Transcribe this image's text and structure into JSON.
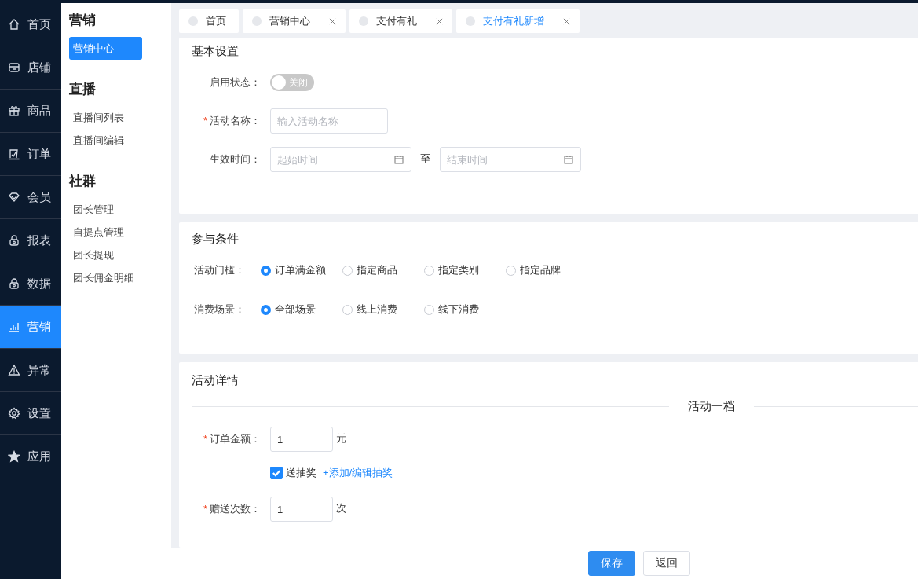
{
  "nav": [
    {
      "label": "首页",
      "kind": "home",
      "selected": false
    },
    {
      "label": "店铺",
      "kind": "store",
      "selected": false
    },
    {
      "label": "商品",
      "kind": "gift",
      "selected": false
    },
    {
      "label": "订单",
      "kind": "order",
      "selected": false
    },
    {
      "label": "会员",
      "kind": "member",
      "selected": false
    },
    {
      "label": "报表",
      "kind": "lock",
      "selected": false
    },
    {
      "label": "数据",
      "kind": "lock",
      "selected": false
    },
    {
      "label": "营销",
      "kind": "chart",
      "selected": true
    },
    {
      "label": "异常",
      "kind": "warning",
      "selected": false
    },
    {
      "label": "设置",
      "kind": "gear",
      "selected": false
    },
    {
      "label": "应用",
      "kind": "star",
      "selected": false
    }
  ],
  "submenu": [
    {
      "title": "营销",
      "items": [
        {
          "label": "营销中心",
          "selected": true
        }
      ]
    },
    {
      "title": "直播",
      "items": [
        {
          "label": "直播间列表",
          "selected": false
        },
        {
          "label": "直播间编辑",
          "selected": false
        }
      ]
    },
    {
      "title": "社群",
      "items": [
        {
          "label": "团长管理",
          "selected": false
        },
        {
          "label": "自提点管理",
          "selected": false
        },
        {
          "label": "团长提现",
          "selected": false
        },
        {
          "label": "团长佣金明细",
          "selected": false
        }
      ]
    }
  ],
  "tabs": [
    {
      "label": "首页",
      "selected": false,
      "closable": false
    },
    {
      "label": "营销中心",
      "selected": false,
      "closable": true
    },
    {
      "label": "支付有礼",
      "selected": false,
      "closable": true
    },
    {
      "label": "支付有礼新增",
      "selected": true,
      "closable": true
    }
  ],
  "basic_settings": {
    "title": "基本设置",
    "status": {
      "label": "启用状态：",
      "on": false,
      "text": "关闭"
    },
    "name": {
      "label": "活动名称：",
      "required_mark": "*",
      "placeholder": "输入活动名称"
    },
    "time": {
      "label": "生效时间：",
      "start_placeholder": "起始时间",
      "separator": "至",
      "end_placeholder": "结束时间"
    }
  },
  "conditions": {
    "title": "参与条件",
    "rows": [
      {
        "label": "活动门槛：",
        "options": [
          {
            "label": "订单满金额",
            "selected": true
          },
          {
            "label": "指定商品",
            "selected": false
          },
          {
            "label": "指定类别",
            "selected": false
          },
          {
            "label": "指定品牌",
            "selected": false
          }
        ]
      },
      {
        "label": "消费场景：",
        "options": [
          {
            "label": "全部场景",
            "selected": true
          },
          {
            "label": "线上消费",
            "selected": false
          },
          {
            "label": "线下消费",
            "selected": false
          }
        ]
      }
    ]
  },
  "details": {
    "title": "活动详情",
    "tier_title": "活动一档",
    "order_amount": {
      "label": "订单金额：",
      "required_mark": "*",
      "value": "1",
      "unit": "元"
    },
    "lottery": {
      "label": "送抽奖",
      "checked": true,
      "link": "+添加/编辑抽奖"
    },
    "gift_count": {
      "label": "赠送次数：",
      "required_mark": "*",
      "value": "1",
      "unit": "次"
    }
  },
  "buttons": [
    {
      "label": "保存",
      "kind": "primary"
    },
    {
      "label": "返回",
      "kind": "default"
    }
  ]
}
